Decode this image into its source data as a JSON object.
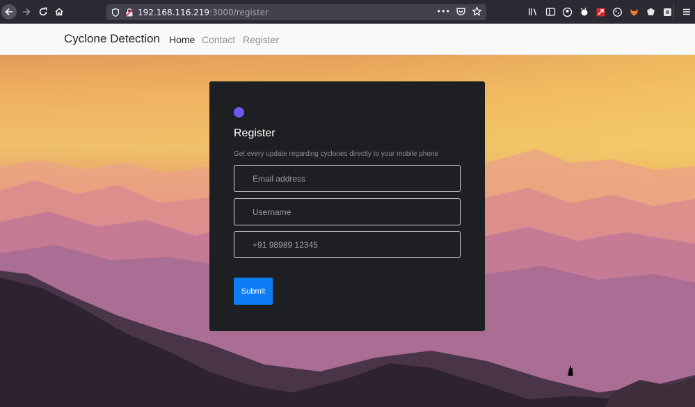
{
  "browser": {
    "url_host": "192.168.116.219",
    "url_path": ":3000/register",
    "page_actions_label": "•••"
  },
  "navbar": {
    "brand": "Cyclone Detection",
    "links": [
      {
        "label": "Home"
      },
      {
        "label": "Contact"
      },
      {
        "label": "Register"
      }
    ]
  },
  "form": {
    "title": "Register",
    "subtitle": "Get every update regarding cyclones directly to your mobile phone",
    "email_placeholder": "Email address",
    "username_placeholder": "Username",
    "phone_placeholder": "+91 98989 12345",
    "submit_label": "Submit"
  },
  "colors": {
    "accent_dot": "#6a5bf0",
    "submit_bg": "#0d7cf5",
    "card_bg": "#1e1f22"
  }
}
